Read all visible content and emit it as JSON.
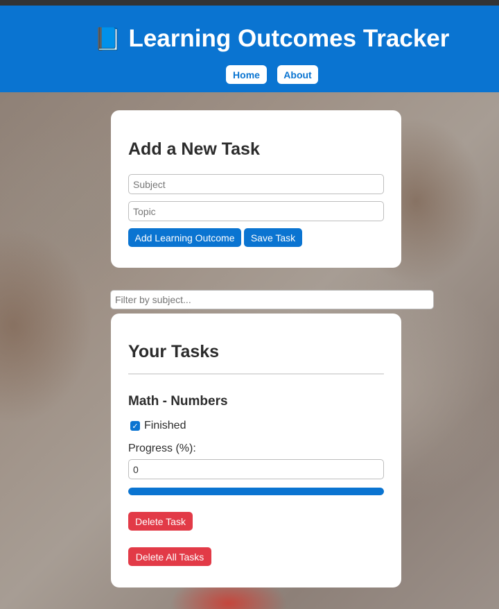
{
  "header": {
    "title": "Learning Outcomes Tracker",
    "title_icon": "📘",
    "nav": [
      {
        "label": "Home"
      },
      {
        "label": "About"
      }
    ]
  },
  "add_task": {
    "heading": "Add a New Task",
    "subject_placeholder": "Subject",
    "topic_placeholder": "Topic",
    "add_outcome_label": "Add Learning Outcome",
    "save_label": "Save Task"
  },
  "filter": {
    "placeholder": "Filter by subject..."
  },
  "tasks_panel": {
    "heading": "Your Tasks",
    "tasks": [
      {
        "title": "Math - Numbers",
        "finished": true,
        "finished_label": "Finished",
        "progress_label": "Progress (%):",
        "progress_value": "0",
        "progress_bar_fraction": 1.0,
        "delete_label": "Delete Task"
      }
    ],
    "delete_all_label": "Delete All Tasks"
  },
  "colors": {
    "primary": "#0a74d1",
    "danger": "#e23a47",
    "topbar": "#333333"
  }
}
